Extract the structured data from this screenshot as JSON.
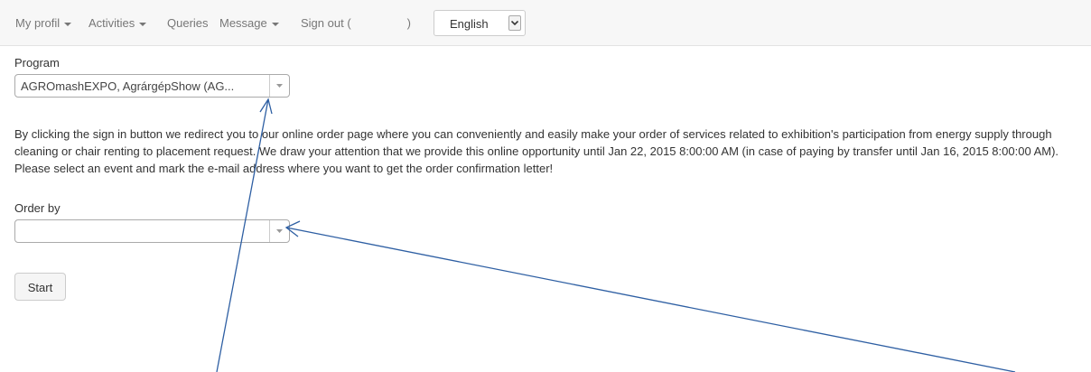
{
  "navbar": {
    "items": [
      {
        "label": "My profil",
        "dropdown": true
      },
      {
        "label": "Activities",
        "dropdown": true
      },
      {
        "label": "Queries",
        "dropdown": false
      },
      {
        "label": "Message",
        "dropdown": true
      }
    ],
    "signout_prefix": "Sign out (",
    "signout_suffix": ")",
    "language": {
      "selected": "English"
    }
  },
  "form": {
    "program": {
      "label": "Program",
      "value": "AGROmashEXPO, AgrárgépShow (AG..."
    },
    "description": "By clicking the sign in button we redirect you to our online order page where you can conveniently and easily make your order of services related to exhibition's participation from energy supply through cleaning or chair renting to placement request. We draw your attention that we provide this online opportunity until Jan 22, 2015 8:00:00 AM (in case of paying by transfer until Jan 16, 2015 8:00:00 AM). Please select an event and mark the e-mail address where you want to get the order confirmation letter!",
    "order_by": {
      "label": "Order by",
      "value": ""
    },
    "start_label": "Start"
  },
  "colors": {
    "navbar_bg": "#f7f7f7",
    "nav_text": "#777777",
    "annotation_arrow": "#2e5fa3"
  },
  "icons": [
    "caret-down-icon",
    "dropdown-arrow-icon"
  ]
}
